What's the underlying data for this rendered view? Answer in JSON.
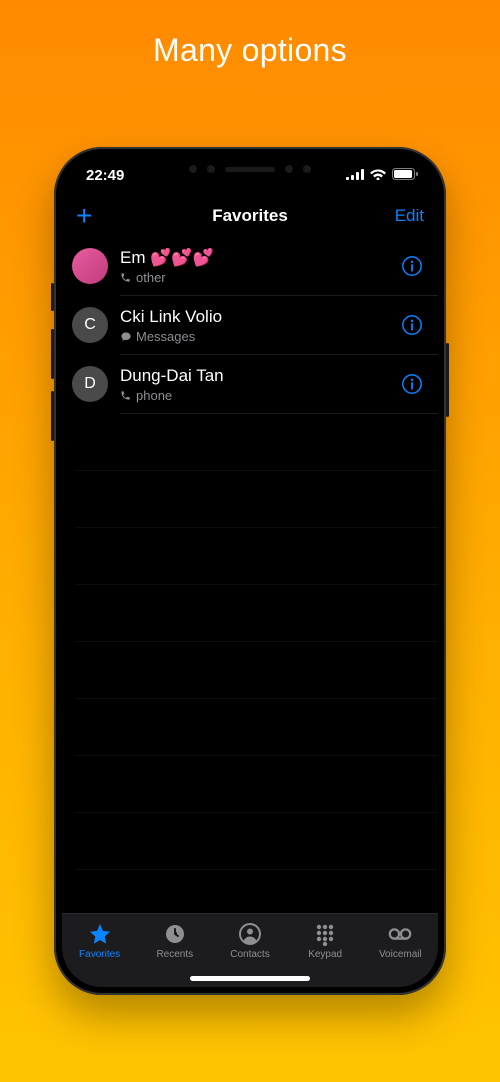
{
  "promo": {
    "title": "Many options"
  },
  "status": {
    "time": "22:49"
  },
  "navbar": {
    "add_label": "+",
    "title": "Favorites",
    "edit_label": "Edit"
  },
  "favorites": [
    {
      "name": "Em 💕💕💕",
      "sub_icon": "phone",
      "sub": "other",
      "avatar_type": "pink",
      "avatar_letter": ""
    },
    {
      "name": "Cki Link Volio",
      "sub_icon": "message",
      "sub": "Messages",
      "avatar_type": "grey",
      "avatar_letter": "C"
    },
    {
      "name": "Dung-Dai Tan",
      "sub_icon": "phone",
      "sub": "phone",
      "avatar_type": "grey",
      "avatar_letter": "D"
    }
  ],
  "tabs": {
    "favorites": "Favorites",
    "recents": "Recents",
    "contacts": "Contacts",
    "keypad": "Keypad",
    "voicemail": "Voicemail"
  }
}
